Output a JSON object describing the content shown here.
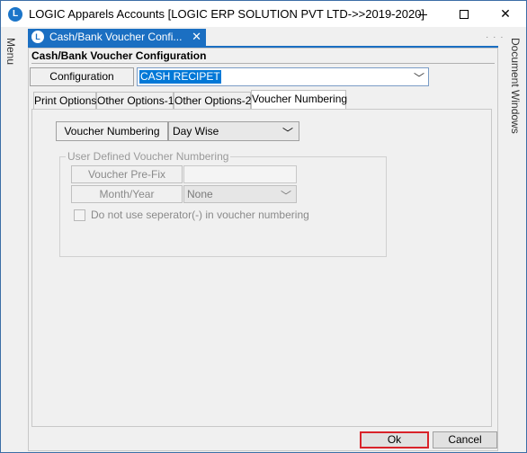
{
  "window": {
    "app_icon": "L",
    "title": "LOGIC Apparels Accounts  [LOGIC ERP SOLUTION PVT LTD->>2019-2020]"
  },
  "side": {
    "left_label": "Menu",
    "right_label": "Document Windows"
  },
  "doc_tab": {
    "label": "Cash/Bank Voucher Confi...",
    "close": "✕"
  },
  "form": {
    "heading": "Cash/Bank Voucher Configuration",
    "config_label": "Configuration",
    "config_value": "CASH RECIPET",
    "tabs": [
      {
        "label": "Print Options"
      },
      {
        "label": "Other Options-1"
      },
      {
        "label": "Other Options-2"
      },
      {
        "label": "Voucher Numbering",
        "active": true
      }
    ],
    "voucher_numbering_label": "Voucher Numbering",
    "voucher_numbering_value": "Day Wise",
    "group_title": "User Defined Voucher Numbering",
    "prefix_label": "Voucher Pre-Fix",
    "prefix_value": "",
    "month_year_label": "Month/Year",
    "month_year_value": "None",
    "separator_checkbox_label": "Do not use seperator(-) in voucher numbering",
    "separator_checked": false
  },
  "buttons": {
    "ok": "Ok",
    "cancel": "Cancel"
  },
  "colors": {
    "accent": "#1b6fc2",
    "selection": "#0078d7",
    "ok_border": "#d9232a"
  }
}
